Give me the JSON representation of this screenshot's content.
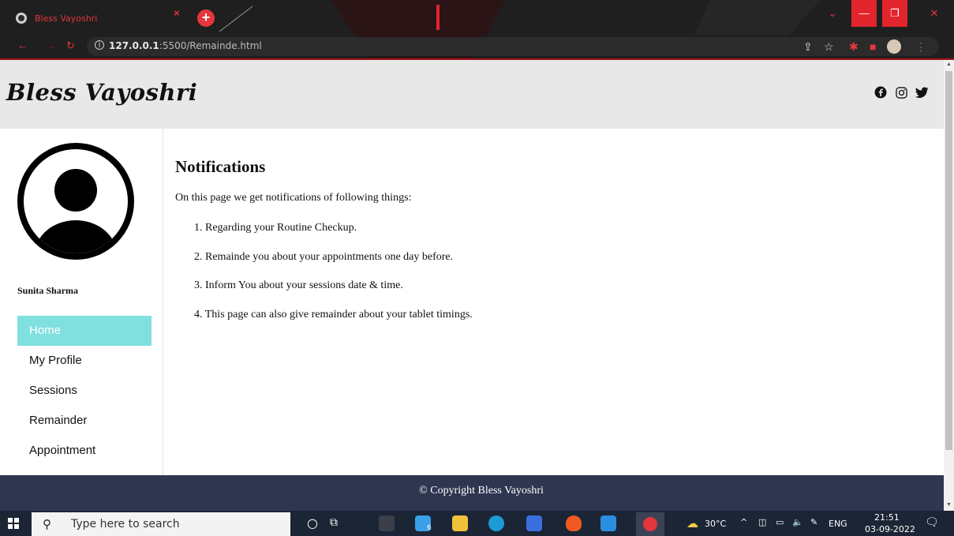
{
  "browser": {
    "tab_title": "Bless Vayoshri",
    "tab_close": "×",
    "new_tab": "+",
    "url_host": "127.0.0.1",
    "url_rest": ":5500/Remainde.html",
    "window_minimize": "—",
    "window_restore": "❐",
    "window_close": "✕",
    "window_dropdown": "⌄"
  },
  "header": {
    "brand": "Bless Vayoshri",
    "social": {
      "facebook": "f",
      "instagram": "◎",
      "twitter": "🐦"
    }
  },
  "sidebar": {
    "user_name": "Sunita Sharma",
    "menu": [
      {
        "label": "Home",
        "active": true
      },
      {
        "label": "My Profile",
        "active": false
      },
      {
        "label": "Sessions",
        "active": false
      },
      {
        "label": "Remainder",
        "active": false
      },
      {
        "label": "Appointment",
        "active": false
      }
    ]
  },
  "main": {
    "title": "Notifications",
    "intro": "On this page we get notifications of following things:",
    "items": [
      "1. Regarding your Routine Checkup.",
      "2. Remainde you about your appointments one day before.",
      "3. Inform You about your sessions date & time.",
      "4. This page can also give remainder about your tablet timings."
    ]
  },
  "footer": {
    "text": "© Copyright Bless Vayoshri"
  },
  "taskbar": {
    "search_placeholder": "Type here to search",
    "weather": "30°C",
    "language": "ENG",
    "time": "21:51",
    "date": "03-09-2022",
    "badge": "6"
  },
  "colors": {
    "accent_active": "#7fe0df",
    "header_bg": "#e8e8e8",
    "footer_bg": "#2e3650",
    "browser_red": "#e5353d"
  }
}
